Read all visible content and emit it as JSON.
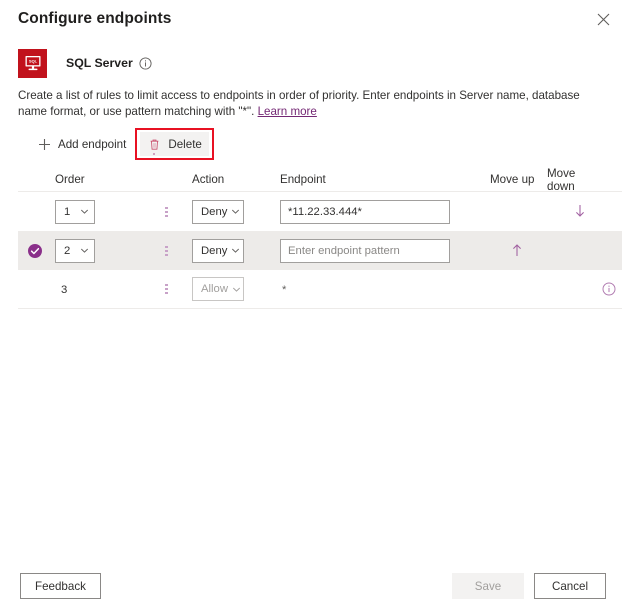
{
  "header": {
    "title": "Configure endpoints",
    "close_icon": "close-icon"
  },
  "resource": {
    "icon": "sql-server-icon",
    "icon_label": "SQL",
    "name": "SQL Server",
    "info_icon": "info-icon"
  },
  "description": {
    "text_before_link": "Create a list of rules to limit access to endpoints in order of priority. Enter endpoints in Server name, database name format, or use pattern matching with \"*\". ",
    "link_text": "Learn more"
  },
  "command_bar": {
    "add_label": "Add endpoint",
    "add_icon": "plus-icon",
    "delete_label": "Delete",
    "delete_icon": "trash-icon",
    "delete_highlight_color": "#e81123"
  },
  "table": {
    "columns": [
      {
        "key": "order",
        "label": "Order"
      },
      {
        "key": "handle",
        "label": ""
      },
      {
        "key": "action",
        "label": "Action"
      },
      {
        "key": "endpoint",
        "label": "Endpoint"
      },
      {
        "key": "move_up",
        "label": "Move up"
      },
      {
        "key": "move_down",
        "label": "Move down"
      }
    ],
    "rows": [
      {
        "selected": false,
        "order": "1",
        "order_editable": true,
        "action": "Deny",
        "action_editable": true,
        "endpoint_value": "*11.22.33.444*",
        "endpoint_placeholder": "Enter endpoint pattern",
        "endpoint_editable": true,
        "move_up": false,
        "move_down": true,
        "row_info": false,
        "striped": false
      },
      {
        "selected": true,
        "order": "2",
        "order_editable": true,
        "action": "Deny",
        "action_editable": true,
        "endpoint_value": "",
        "endpoint_placeholder": "Enter endpoint pattern",
        "endpoint_editable": true,
        "move_up": true,
        "move_down": false,
        "row_info": false,
        "striped": true
      },
      {
        "selected": false,
        "order": "3",
        "order_editable": false,
        "action": "Allow",
        "action_editable": false,
        "endpoint_value": "*",
        "endpoint_placeholder": "",
        "endpoint_editable": false,
        "move_up": false,
        "move_down": false,
        "row_info": true,
        "striped": false
      }
    ]
  },
  "footer": {
    "feedback_label": "Feedback",
    "save_label": "Save",
    "save_disabled": true,
    "cancel_label": "Cancel"
  },
  "colors": {
    "accent": "#742774",
    "brand_red": "#c1121c",
    "highlight_red": "#e81123",
    "stripe": "#edebe9"
  }
}
